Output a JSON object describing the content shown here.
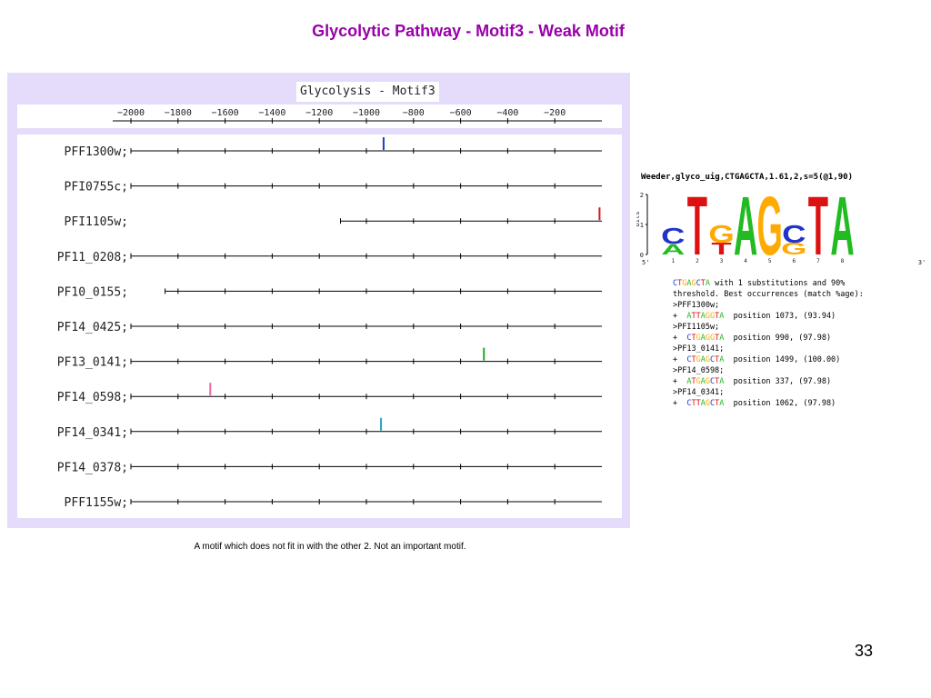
{
  "slide": {
    "title": "Glycolytic Pathway - Motif3 - Weak Motif",
    "caption": "A motif which does not fit in with the other 2.  Not an important motif.",
    "page_number": "33"
  },
  "plot": {
    "title": "Glycolysis - Motif3",
    "axis_ticks": [
      -2000,
      -1800,
      -1600,
      -1400,
      -1200,
      -1000,
      -800,
      -600,
      -400,
      -200
    ],
    "axis_range": [
      -2000,
      0
    ],
    "genes": [
      {
        "label": "PFF1300w;",
        "start": -2000,
        "motifs": [
          {
            "pos": -927,
            "color": "#1a3ccc"
          }
        ]
      },
      {
        "label": "PFI0755c;",
        "start": -2000,
        "motifs": []
      },
      {
        "label": "PFI1105w;",
        "start": -1110,
        "motifs": [
          {
            "pos": -10,
            "color": "#cc1a1a"
          }
        ]
      },
      {
        "label": "PF11_0208;",
        "start": -2000,
        "motifs": []
      },
      {
        "label": "PF10_0155;",
        "start": -1855,
        "motifs": []
      },
      {
        "label": "PF14_0425;",
        "start": -2000,
        "motifs": []
      },
      {
        "label": "PF13_0141;",
        "start": -2000,
        "motifs": [
          {
            "pos": -501,
            "color": "#22aa22"
          }
        ]
      },
      {
        "label": "PF14_0598;",
        "start": -2000,
        "motifs": [
          {
            "pos": -1663,
            "color": "#ee66aa"
          }
        ]
      },
      {
        "label": "PF14_0341;",
        "start": -2000,
        "motifs": [
          {
            "pos": -938,
            "color": "#22aabb"
          }
        ]
      },
      {
        "label": "PF14_0378;",
        "start": -2000,
        "motifs": []
      },
      {
        "label": "PFF1155w;",
        "start": -2000,
        "motifs": []
      }
    ]
  },
  "logo": {
    "header": "Weeder,glyco_uig,CTGAGCTA,1.61,2,s=5(@1,90)",
    "ylabel": "bits",
    "yticks": [
      "2",
      "1",
      "0"
    ],
    "left_end": "5'",
    "right_end": "3'",
    "positions": [
      "1",
      "2",
      "3",
      "4",
      "5",
      "6",
      "7",
      "8"
    ],
    "colors": {
      "A": "#22bb22",
      "C": "#2233cc",
      "G": "#ffaa00",
      "T": "#dd1111"
    },
    "columns": [
      [
        {
          "l": "A",
          "h": 0.35
        },
        {
          "l": "C",
          "h": 0.55
        }
      ],
      [
        {
          "l": "T",
          "h": 2.0
        }
      ],
      [
        {
          "l": "T",
          "h": 0.4
        },
        {
          "l": "G",
          "h": 0.6
        }
      ],
      [
        {
          "l": "A",
          "h": 2.0
        }
      ],
      [
        {
          "l": "G",
          "h": 2.0
        }
      ],
      [
        {
          "l": "G",
          "h": 0.4
        },
        {
          "l": "C",
          "h": 0.6
        }
      ],
      [
        {
          "l": "T",
          "h": 2.0
        }
      ],
      [
        {
          "l": "A",
          "h": 2.0
        }
      ]
    ]
  },
  "report": {
    "lines": [
      {
        "seq": "CTGAGCTA",
        "text": " with 1 substitutions and 90%"
      },
      {
        "text": "threshold. Best occurrences (match %age):"
      },
      {
        "text": ">PFF1300w;"
      },
      {
        "prefix": "+  ",
        "seq": "ATTAGGTA",
        "text": "  position 1073, (93.94)"
      },
      {
        "text": ">PFI1105w;"
      },
      {
        "prefix": "+  ",
        "seq": "CTGAGGTA",
        "text": "  position 990, (97.98)"
      },
      {
        "text": ">PF13_0141;"
      },
      {
        "prefix": "+  ",
        "seq": "CTGAGCTA",
        "text": "  position 1499, (100.00)"
      },
      {
        "text": ">PF14_0598;"
      },
      {
        "prefix": "+  ",
        "seq": "ATGAGCTA",
        "text": "  position 337, (97.98)"
      },
      {
        "text": ">PF14_0341;"
      },
      {
        "prefix": "+  ",
        "seq": "CTTAGCTA",
        "text": "  position 1062, (97.98)"
      }
    ]
  }
}
